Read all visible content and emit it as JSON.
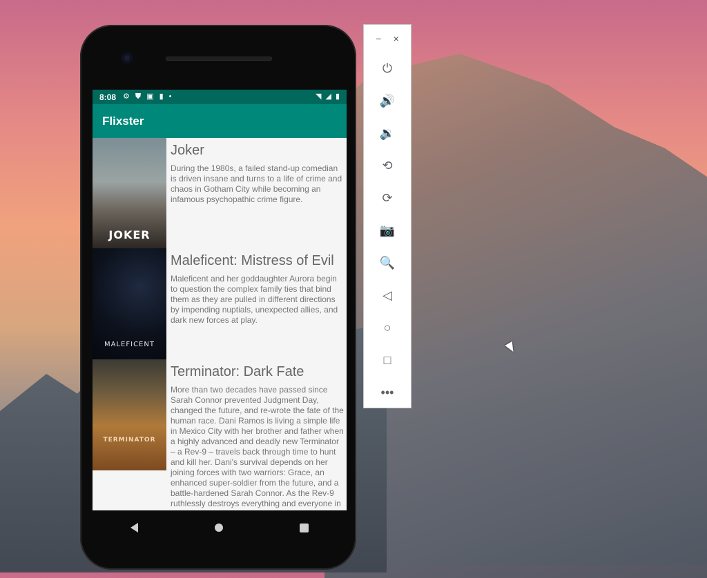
{
  "status_bar": {
    "time": "8:08",
    "left_icons": [
      "settings-icon",
      "shield-icon",
      "a-icon",
      "sd-card-icon",
      "dot-icon"
    ],
    "right_icons": [
      "wifi-icon",
      "signal-icon",
      "battery-icon"
    ]
  },
  "app_bar": {
    "title": "Flixster"
  },
  "movies": [
    {
      "title": "Joker",
      "overview": "During the 1980s, a failed stand-up comedian is driven insane and turns to a life of crime and chaos in Gotham City while becoming an infamous psychopathic crime figure.",
      "poster_text": "JOKER"
    },
    {
      "title": "Maleficent: Mistress of Evil",
      "overview": "Maleficent and her goddaughter Aurora begin to question the complex family ties that bind them as they are pulled in different directions by impending nuptials, unexpected allies, and dark new forces at play.",
      "poster_text": "MALEFICENT"
    },
    {
      "title": "Terminator: Dark Fate",
      "overview": "More than two decades have passed since Sarah Connor prevented Judgment Day, changed the future, and re-wrote the fate of the human race. Dani Ramos is living a simple life in Mexico City with her brother and father when a highly advanced and deadly new Terminator – a Rev-9 – travels back through time to hunt and kill her. Dani's survival depends on her joining forces with two warriors: Grace, an enhanced super-soldier from the future, and a battle-hardened Sarah Connor. As the Rev-9 ruthlessly destroys everything and everyone in its path on the",
      "poster_text": "TERMINATOR"
    }
  ],
  "emulator_toolbar": {
    "minimize": "−",
    "close": "×",
    "tools": [
      {
        "name": "power-icon",
        "glyph": "⏻"
      },
      {
        "name": "volume-up-icon",
        "glyph": "🔊"
      },
      {
        "name": "volume-down-icon",
        "glyph": "🔉"
      },
      {
        "name": "rotate-left-icon",
        "glyph": "⟲"
      },
      {
        "name": "rotate-right-icon",
        "glyph": "⟳"
      },
      {
        "name": "camera-icon",
        "glyph": "📷"
      },
      {
        "name": "zoom-icon",
        "glyph": "🔍"
      },
      {
        "name": "back-icon",
        "glyph": "◁"
      },
      {
        "name": "home-icon",
        "glyph": "○"
      },
      {
        "name": "overview-icon",
        "glyph": "□"
      },
      {
        "name": "more-icon",
        "glyph": "•••"
      }
    ]
  }
}
